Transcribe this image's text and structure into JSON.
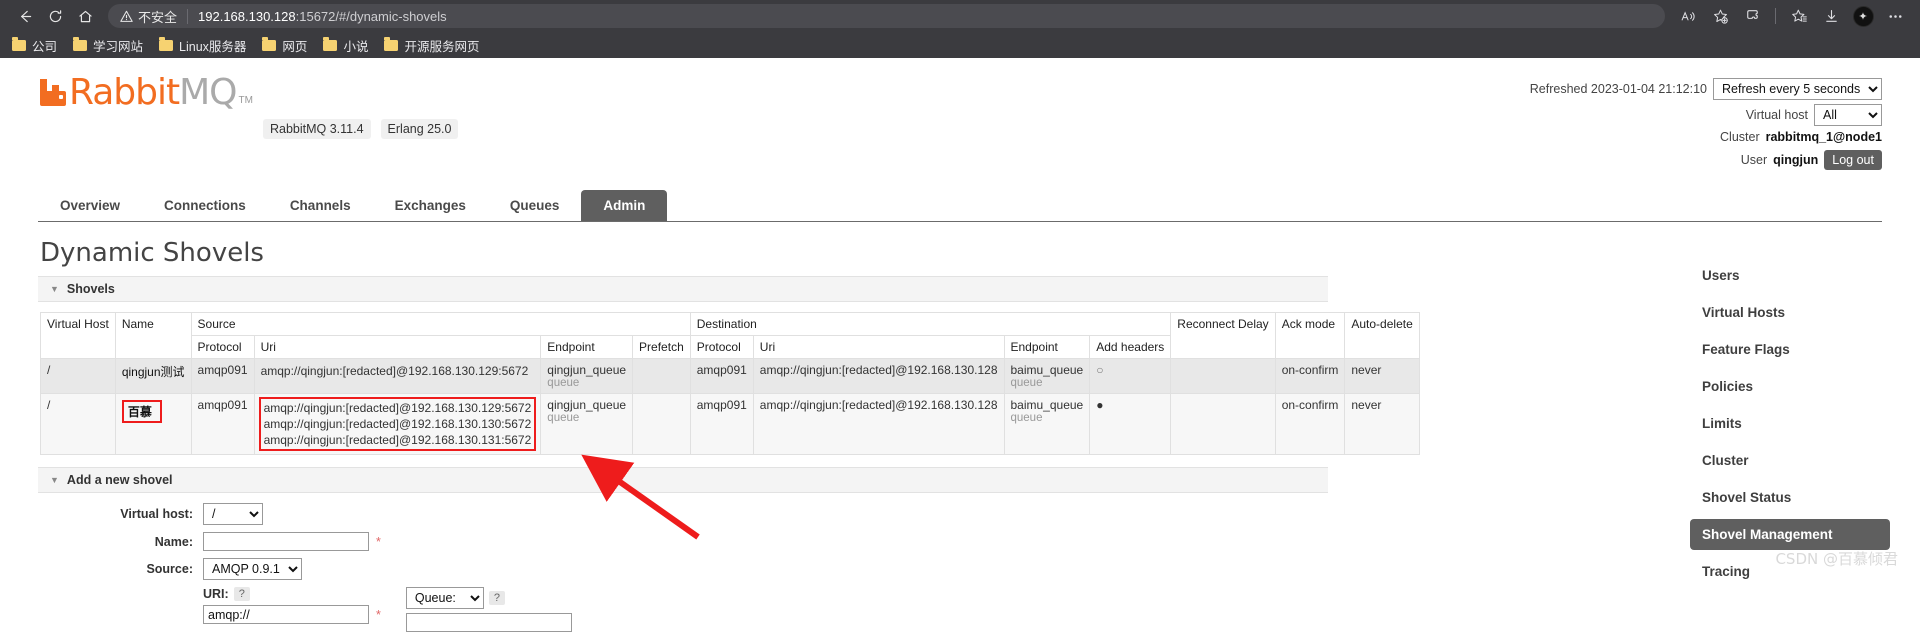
{
  "browser": {
    "back_icon": "back-arrow-icon",
    "reload_icon": "reload-icon",
    "home_icon": "home-icon",
    "security_label": "不安全",
    "url_host": "192.168.130.128",
    "url_rest": ":15672/#/dynamic-shovels",
    "bookmarks": [
      {
        "label": "公司"
      },
      {
        "label": "学习网站"
      },
      {
        "label": "Linux服务器"
      },
      {
        "label": "网页"
      },
      {
        "label": "小说"
      },
      {
        "label": "开源服务网页"
      }
    ],
    "toolbar_icons": [
      "read-aloud-icon",
      "add-favorite-icon",
      "collections-icon",
      "favorites-icon",
      "downloads-icon",
      "profile-avatar",
      "settings-more-icon"
    ],
    "avatar_initial": "✦"
  },
  "header": {
    "logo_rabbit": "Rabbit",
    "logo_mq": "MQ",
    "logo_tm": "TM",
    "version_pill": "RabbitMQ 3.11.4",
    "erlang_pill": "Erlang 25.0",
    "refreshed_label": "Refreshed 2023-01-04 21:12:10",
    "refresh_select": "Refresh every 5 seconds",
    "refresh_options": [
      "Refresh every 5 seconds"
    ],
    "vhost_label": "Virtual host",
    "vhost_select": "All",
    "vhost_options": [
      "All"
    ],
    "cluster_label": "Cluster",
    "cluster_value": "rabbitmq_1@node1",
    "user_label": "User",
    "user_value": "qingjun",
    "logout_label": "Log out"
  },
  "tabs": [
    {
      "label": "Overview",
      "active": false
    },
    {
      "label": "Connections",
      "active": false
    },
    {
      "label": "Channels",
      "active": false
    },
    {
      "label": "Exchanges",
      "active": false
    },
    {
      "label": "Queues",
      "active": false
    },
    {
      "label": "Admin",
      "active": true
    }
  ],
  "main": {
    "page_title": "Dynamic Shovels",
    "shovels_section": "Shovels",
    "add_section": "Add a new shovel"
  },
  "table": {
    "group_headers": {
      "virtual_host": "Virtual Host",
      "name": "Name",
      "source": "Source",
      "destination": "Destination",
      "reconnect_delay": "Reconnect Delay",
      "ack_mode": "Ack mode",
      "auto_delete": "Auto-delete"
    },
    "sub_headers": {
      "src_protocol": "Protocol",
      "src_uri": "Uri",
      "src_endpoint": "Endpoint",
      "prefetch": "Prefetch",
      "dst_protocol": "Protocol",
      "dst_uri": "Uri",
      "dst_endpoint": "Endpoint",
      "add_headers": "Add headers"
    },
    "rows": [
      {
        "vhost": "/",
        "name": "qingjun测试",
        "src_protocol": "amqp091",
        "src_uris": [
          "amqp://qingjun:[redacted]@192.168.130.129:5672"
        ],
        "src_endpoint": "qingjun_queue",
        "src_endpoint_sub": "queue",
        "prefetch": "",
        "dst_protocol": "amqp091",
        "dst_uri": "amqp://qingjun:[redacted]@192.168.130.128",
        "dst_endpoint": "baimu_queue",
        "dst_endpoint_sub": "queue",
        "add_headers": "○",
        "reconnect_delay": "",
        "ack_mode": "on-confirm",
        "auto_delete": "never",
        "name_highlighted": false,
        "uri_highlighted": false
      },
      {
        "vhost": "/",
        "name": "百慕",
        "src_protocol": "amqp091",
        "src_uris": [
          "amqp://qingjun:[redacted]@192.168.130.129:5672",
          "amqp://qingjun:[redacted]@192.168.130.130:5672",
          "amqp://qingjun:[redacted]@192.168.130.131:5672"
        ],
        "src_endpoint": "qingjun_queue",
        "src_endpoint_sub": "queue",
        "prefetch": "",
        "dst_protocol": "amqp091",
        "dst_uri": "amqp://qingjun:[redacted]@192.168.130.128",
        "dst_endpoint": "baimu_queue",
        "dst_endpoint_sub": "queue",
        "add_headers": "●",
        "reconnect_delay": "",
        "ack_mode": "on-confirm",
        "auto_delete": "never",
        "name_highlighted": true,
        "uri_highlighted": true
      }
    ]
  },
  "form": {
    "vhost_label": "Virtual host:",
    "vhost_value": "/",
    "vhost_options": [
      "/"
    ],
    "name_label": "Name:",
    "name_value": "",
    "name_required": "*",
    "source_label": "Source:",
    "source_value": "AMQP 0.9.1",
    "source_options": [
      "AMQP 0.9.1"
    ],
    "uri_label": "URI:",
    "uri_help": "?",
    "uri_value": "amqp://",
    "uri_required": "*",
    "queue_label": "Queue:",
    "queue_options": [
      "Queue:"
    ],
    "queue_help": "?",
    "queue_value": ""
  },
  "rightnav": [
    {
      "label": "Users",
      "active": false
    },
    {
      "label": "Virtual Hosts",
      "active": false
    },
    {
      "label": "Feature Flags",
      "active": false
    },
    {
      "label": "Policies",
      "active": false
    },
    {
      "label": "Limits",
      "active": false
    },
    {
      "label": "Cluster",
      "active": false
    },
    {
      "label": "Shovel Status",
      "active": false
    },
    {
      "label": "Shovel Management",
      "active": true
    },
    {
      "label": "Tracing",
      "active": false
    }
  ],
  "watermark": "CSDN @百慕倾君",
  "colors": {
    "brand_orange": "#f26d21",
    "chrome_bg": "#3b3b3f",
    "active_tab": "#5f5f5f",
    "highlight_red": "#ee1c1c"
  }
}
